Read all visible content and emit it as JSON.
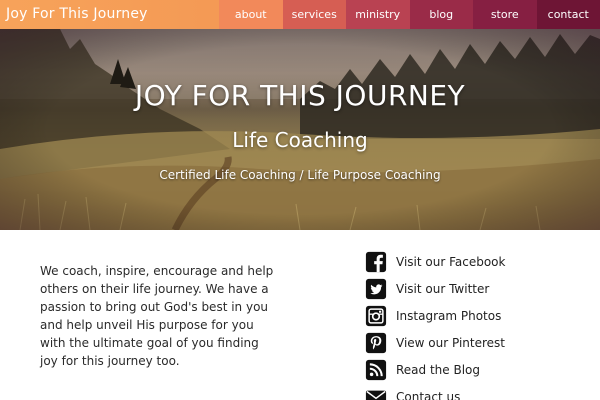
{
  "header": {
    "brand": "Joy For This Journey",
    "nav": [
      {
        "label": "about",
        "color": "#f2895a"
      },
      {
        "label": "services",
        "color": "#d65e53"
      },
      {
        "label": "ministry",
        "color": "#b94252"
      },
      {
        "label": "blog",
        "color": "#9a2b48"
      },
      {
        "label": "store",
        "color": "#861f42"
      },
      {
        "label": "contact",
        "color": "#6e1535"
      }
    ]
  },
  "hero": {
    "title": "JOY FOR THIS JOURNEY",
    "subtitle": "Life Coaching",
    "tagline": "Certified Life Coaching / Life Purpose Coaching"
  },
  "intro": {
    "text": "We coach, inspire, encourage and help others on their life journey. We have a passion to bring out God's best in you and help unveil His purpose for you with the ultimate goal of you finding joy for this journey too."
  },
  "links": [
    {
      "icon": "facebook-icon",
      "label": "Visit our Facebook"
    },
    {
      "icon": "twitter-icon",
      "label": "Visit our Twitter"
    },
    {
      "icon": "instagram-icon",
      "label": "Instagram Photos"
    },
    {
      "icon": "pinterest-icon",
      "label": "View our Pinterest"
    },
    {
      "icon": "rss-icon",
      "label": "Read the Blog"
    },
    {
      "icon": "envelope-icon",
      "label": "Contact us"
    }
  ]
}
